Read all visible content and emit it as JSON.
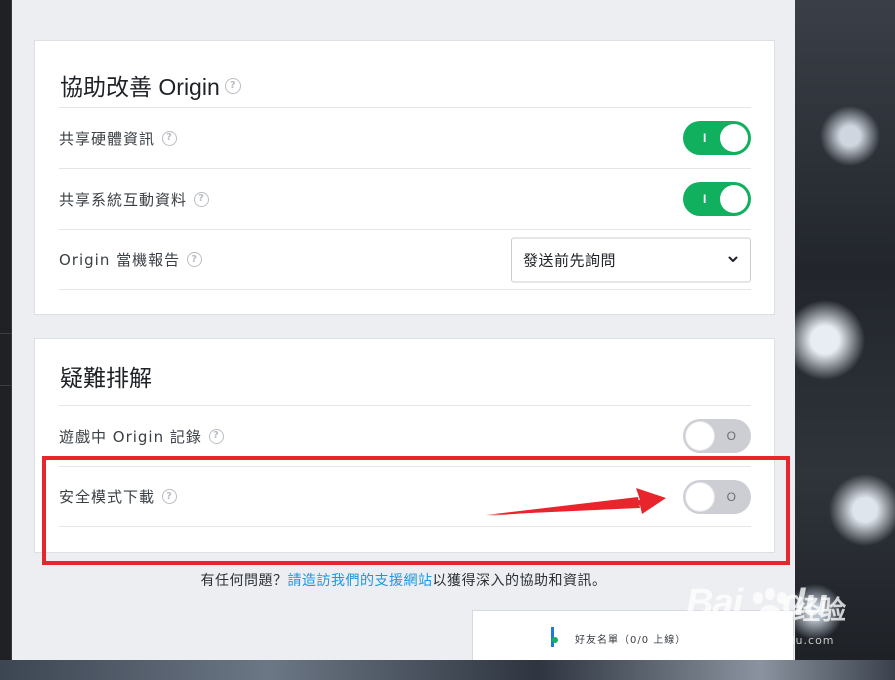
{
  "section_improve": {
    "title": "協助改善 Origin",
    "rows": [
      {
        "label": "共享硬體資訊",
        "toggle": "on",
        "toggle_mark": "I"
      },
      {
        "label": "共享系統互動資料",
        "toggle": "on",
        "toggle_mark": "I"
      },
      {
        "label": "Origin 當機報告",
        "select_value": "發送前先詢問"
      }
    ]
  },
  "section_troubleshoot": {
    "title": "疑難排解",
    "rows": [
      {
        "label": "遊戲中 Origin 記錄",
        "toggle": "off",
        "toggle_mark": "O"
      },
      {
        "label": "安全模式下載",
        "toggle": "off",
        "toggle_mark": "O"
      }
    ]
  },
  "help_icon_glyph": "?",
  "footer": {
    "prefix": "有任何問題？",
    "link": "請造訪我們的支援網站",
    "suffix": "以獲得深入的協助和資訊。"
  },
  "friends_bar": {
    "label": "好友名單（0/0 上線）"
  },
  "watermark": {
    "brand": "Bai",
    "brand2": "du",
    "cn": "经验",
    "url": "jingyan.baidu.com"
  },
  "colors": {
    "toggle_on": "#10b05f",
    "toggle_off": "#ccced4",
    "link": "#1c97e0",
    "annotation": "#e8242c"
  },
  "icons": [
    "help-circle-icon",
    "chevron-down-icon",
    "paw-icon"
  ]
}
